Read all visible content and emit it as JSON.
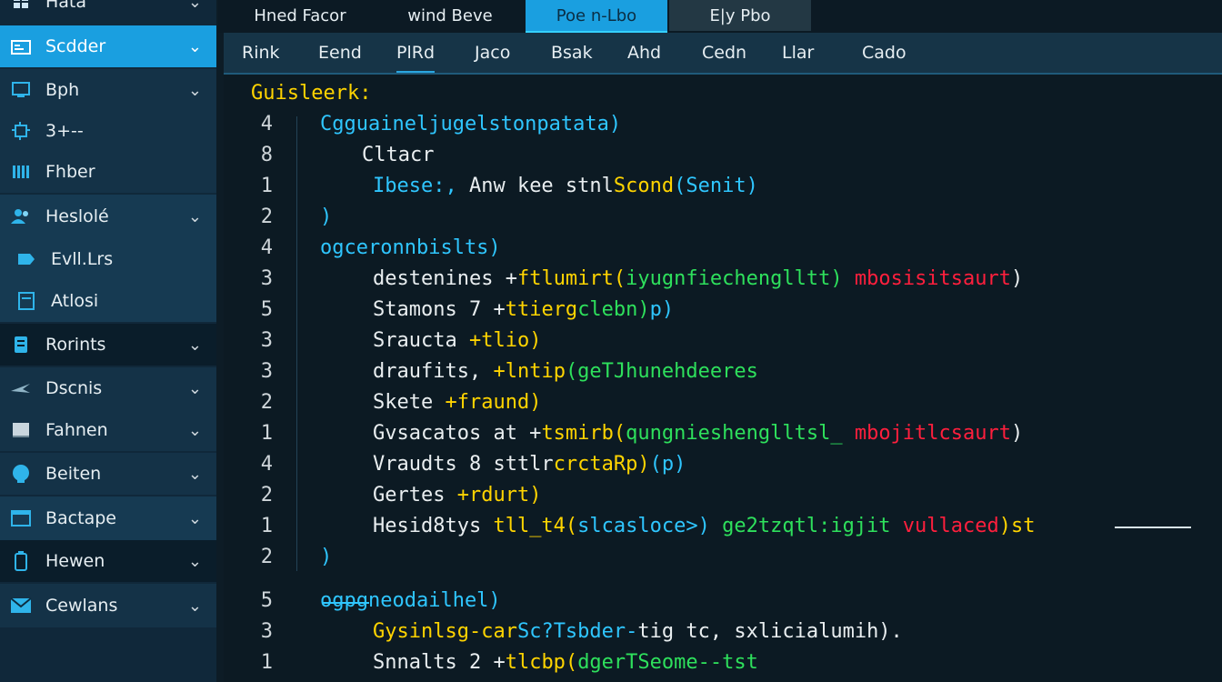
{
  "sidebar": {
    "items": [
      {
        "label": "Hata",
        "icon": "grid-icon"
      },
      {
        "label": "Scdder",
        "icon": "folder-icon"
      },
      {
        "label": "Bph",
        "icon": "monitor-icon"
      },
      {
        "label": "3+--",
        "icon": "chip-icon"
      },
      {
        "label": "Fhber",
        "icon": "bars-icon"
      },
      {
        "label": "Heslolé",
        "icon": "users-icon"
      },
      {
        "label": "Evll.Lrs",
        "icon": "tag-icon"
      },
      {
        "label": "Atlosi",
        "icon": "file-icon"
      },
      {
        "label": "Rorints",
        "icon": "server-icon"
      },
      {
        "label": "Dscnis",
        "icon": "plane-icon"
      },
      {
        "label": "Fahnen",
        "icon": "panel-icon"
      },
      {
        "label": "Beiten",
        "icon": "globe-icon"
      },
      {
        "label": "Bactape",
        "icon": "window-icon"
      },
      {
        "label": "Hewen",
        "icon": "battery-icon"
      },
      {
        "label": "Cewlans",
        "icon": "mail-icon"
      }
    ]
  },
  "tabs": [
    "Hned Facor",
    "wind Beve",
    "Poe n-Lbo",
    "E|y Pbo"
  ],
  "menu": [
    "Rink",
    "Eend",
    "PlRd",
    "Jaco",
    "Bsak",
    "Ahd",
    "Cedn",
    "Llar",
    "Cado"
  ],
  "editor": {
    "header": "Guisleerk:",
    "lines": [
      {
        "n": "4",
        "segs": [
          [
            "Cgguaineljugelstonpatata)",
            "cyan"
          ]
        ]
      },
      {
        "n": "8",
        "segs": [
          [
            "Cltacr",
            "white"
          ]
        ]
      },
      {
        "n": "1",
        "segs": [
          [
            "Ibese:,",
            "cyan"
          ],
          [
            " Anw kee stnl",
            "white"
          ],
          [
            "Scond",
            "yellow"
          ],
          [
            "(Senit)",
            "cyan"
          ]
        ]
      },
      {
        "n": "2",
        "segs": [
          [
            ")",
            "cyan"
          ]
        ]
      },
      {
        "n": "4",
        "segs": [
          [
            "ogceronnbislts)",
            "cyan"
          ]
        ]
      },
      {
        "n": "3",
        "segs": [
          [
            "destenines +",
            "white"
          ],
          [
            "ftlumirt(",
            "yellow"
          ],
          [
            "iyugnfiechenglltt)",
            "green"
          ],
          [
            " mbosisitsaurt",
            "red"
          ],
          [
            ")",
            "white"
          ]
        ]
      },
      {
        "n": "5",
        "segs": [
          [
            "Stamons 7 +",
            "white"
          ],
          [
            "ttierg",
            "yellow"
          ],
          [
            "clebn)",
            "green"
          ],
          [
            "p)",
            "cyan"
          ]
        ]
      },
      {
        "n": "3",
        "segs": [
          [
            "Sraucta ",
            "white"
          ],
          [
            "+tlio)",
            "yellow"
          ]
        ]
      },
      {
        "n": "3",
        "segs": [
          [
            "draufits,",
            "white"
          ],
          [
            " +lntip",
            "yellow"
          ],
          [
            "(geTJhunehdeeres",
            "green"
          ]
        ]
      },
      {
        "n": "2",
        "segs": [
          [
            "Skete ",
            "white"
          ],
          [
            "+fraund)",
            "yellow"
          ]
        ]
      },
      {
        "n": "1",
        "segs": [
          [
            "Gvsacatos at +",
            "white"
          ],
          [
            "tsmirb(",
            "yellow"
          ],
          [
            "qungnieshenglltsl_",
            "green"
          ],
          [
            " mbojitlcsaurt",
            "red"
          ],
          [
            ")",
            "white"
          ]
        ]
      },
      {
        "n": "4",
        "segs": [
          [
            "Vraudts 8 sttlr",
            "white"
          ],
          [
            "crctaRp)",
            "yellow"
          ],
          [
            "(p)",
            "cyan"
          ]
        ]
      },
      {
        "n": "2",
        "segs": [
          [
            "Gertes ",
            "white"
          ],
          [
            "+rdurt)",
            "yellow"
          ]
        ]
      },
      {
        "n": "1",
        "segs": [
          [
            "Hesid8tys ",
            "white"
          ],
          [
            "tll_t4(",
            "yellow"
          ],
          [
            "slcasloce>)",
            "cyan"
          ],
          [
            " ge2tzqtl:igjit",
            "green"
          ],
          [
            " vullaced",
            "red"
          ],
          [
            ")st",
            "yellow"
          ]
        ]
      },
      {
        "n": "2",
        "segs": [
          [
            ")",
            "cyan"
          ]
        ]
      },
      {
        "n": "5",
        "segs": [
          [
            "ogpgneodailhel)",
            "cyan"
          ]
        ]
      },
      {
        "n": "3",
        "segs": [
          [
            "G",
            "yellow"
          ],
          [
            "ysinlsg-car",
            "yellow"
          ],
          [
            "Sc?Tsbder-",
            "cyan"
          ],
          [
            "tig tc, sxlicialumih).",
            "white"
          ]
        ]
      },
      {
        "n": "1",
        "segs": [
          [
            "Snnalts 2 +",
            "white"
          ],
          [
            "tlcbp(",
            "yellow"
          ],
          [
            "dgerTSeome--",
            "green"
          ],
          [
            "tst",
            "green"
          ]
        ]
      }
    ]
  }
}
